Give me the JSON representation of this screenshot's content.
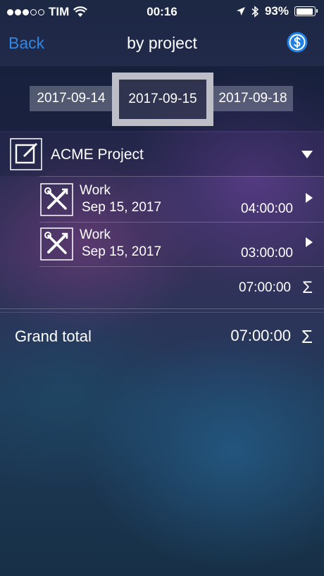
{
  "status": {
    "carrier": "TIM",
    "time": "00:16",
    "battery_text": "93%",
    "battery_level": 0.93
  },
  "nav": {
    "back_label": "Back",
    "title": "by project",
    "coin_icon": "dollar-coin-icon"
  },
  "date_tabs": [
    {
      "label": "2017-09-14"
    },
    {
      "label": "2017-09-15",
      "selected": true
    },
    {
      "label": "2017-09-18"
    }
  ],
  "project": {
    "name": "ACME Project",
    "icon": "edit-icon",
    "entries": [
      {
        "name": "Work",
        "date": "Sep 15, 2017",
        "duration": "04:00:00",
        "icon": "tools-icon"
      },
      {
        "name": "Work",
        "date": "Sep 15, 2017",
        "duration": "03:00:00",
        "icon": "tools-icon"
      }
    ],
    "subtotal": "07:00:00"
  },
  "grand_total": {
    "label": "Grand total",
    "value": "07:00:00"
  },
  "symbols": {
    "sigma": "Σ"
  },
  "colors": {
    "accent": "#2f87e6"
  }
}
